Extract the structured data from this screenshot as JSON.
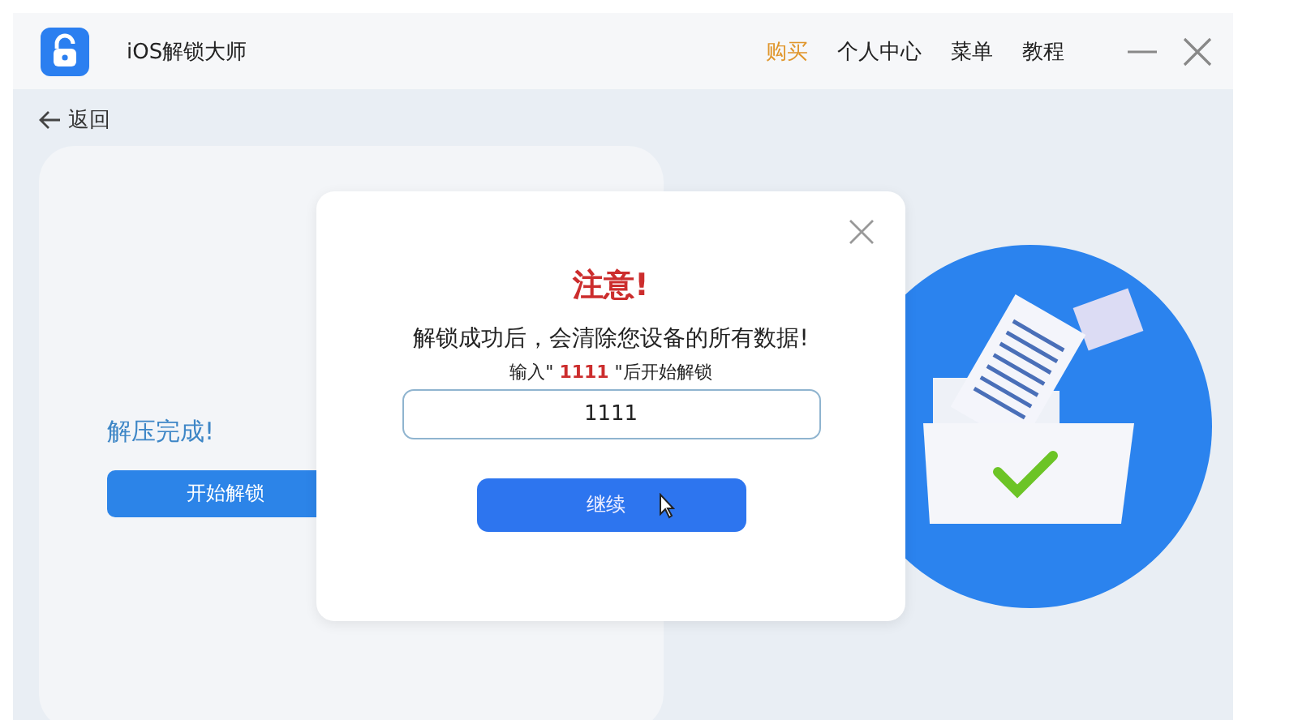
{
  "window": {
    "title": "iOS解锁大师"
  },
  "nav": [
    {
      "label": "购买",
      "selected": true
    },
    {
      "label": "个人中心",
      "selected": false
    },
    {
      "label": "菜单",
      "selected": false
    },
    {
      "label": "教程",
      "selected": false
    }
  ],
  "back": {
    "label": "返回"
  },
  "status": {
    "title": "解压完成!",
    "button": "开始解锁"
  },
  "dialog": {
    "heading": "注意!",
    "message": "解锁成功后，会清除您设备的所有数据!",
    "hint_prefix": "输入\" ",
    "hint_code": "1111",
    "hint_suffix": " \"后开始解锁",
    "input_value": "1111",
    "button": "继续"
  }
}
